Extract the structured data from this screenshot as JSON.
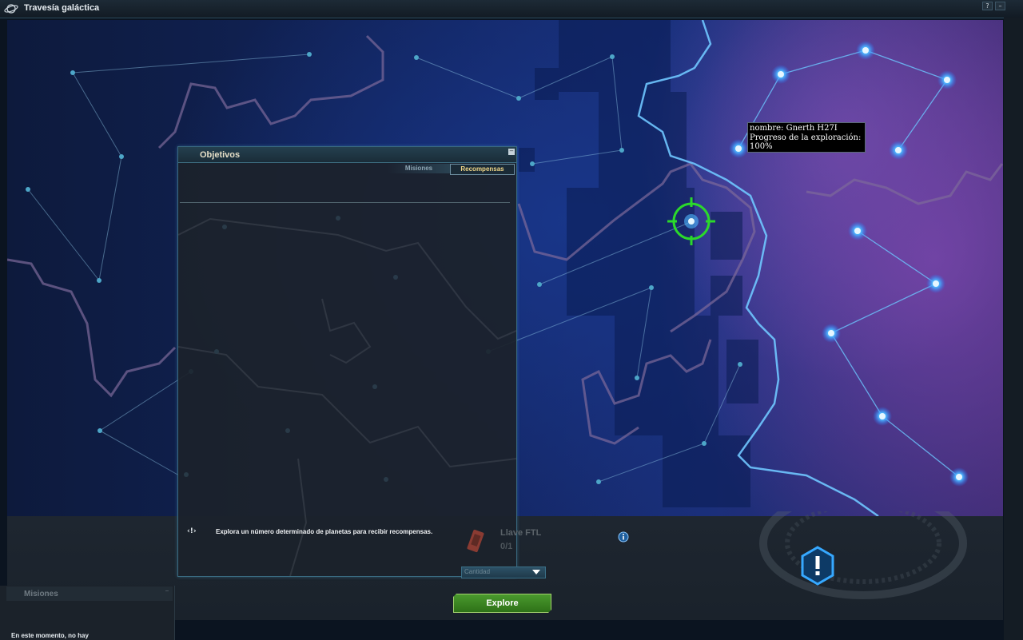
{
  "window": {
    "title": "Travesía galáctica",
    "help_label": "?",
    "minimize_label": "–"
  },
  "tooltip": {
    "line1": "nombre: Gnerth H27I",
    "line2": "Progreso de la exploración:",
    "line3": "100%"
  },
  "objectives_panel": {
    "title": "Objetivos",
    "minimize_label": "–",
    "tabs": [
      {
        "label": "Misiones",
        "active": false
      },
      {
        "label": "Recompensas",
        "active": true
      }
    ],
    "objective_icon": "‹!›",
    "objective_text": "Explora un número determinado de planetas para recibir recompensas."
  },
  "reward": {
    "name": "Llave FTL",
    "count": "0/1",
    "dropdown_label": "Cantidad"
  },
  "explore_button": {
    "label": "Explore"
  },
  "missions_panel": {
    "title": "Misiones",
    "status": "En este momento, no hay"
  },
  "colors": {
    "accent_cyan": "#4fb8ff",
    "target_green": "#2bd92b",
    "explore_green": "#3c8a24",
    "tab_active_text": "#f2d889"
  },
  "icons": {
    "window": "planet-icon",
    "info": "info-icon",
    "alert": "alert-hexagon-icon",
    "target": "crosshair-icon",
    "reward": "ftl-key-icon"
  }
}
